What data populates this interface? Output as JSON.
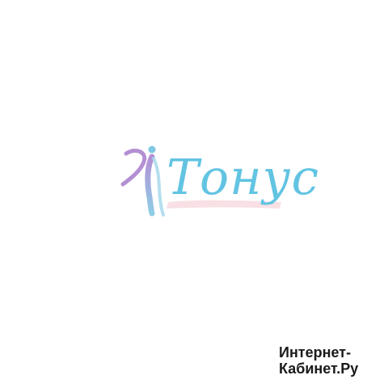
{
  "logo": {
    "wordmark": "Тонус",
    "colors": {
      "primary": "#62c4e2",
      "accent_purple": "#b48fd4",
      "accent_pink": "#f6d6dc"
    },
    "icon": "figure-swirl-icon"
  },
  "watermark": {
    "line1": "Интернет-",
    "line2": "Кабинет.Ру"
  }
}
